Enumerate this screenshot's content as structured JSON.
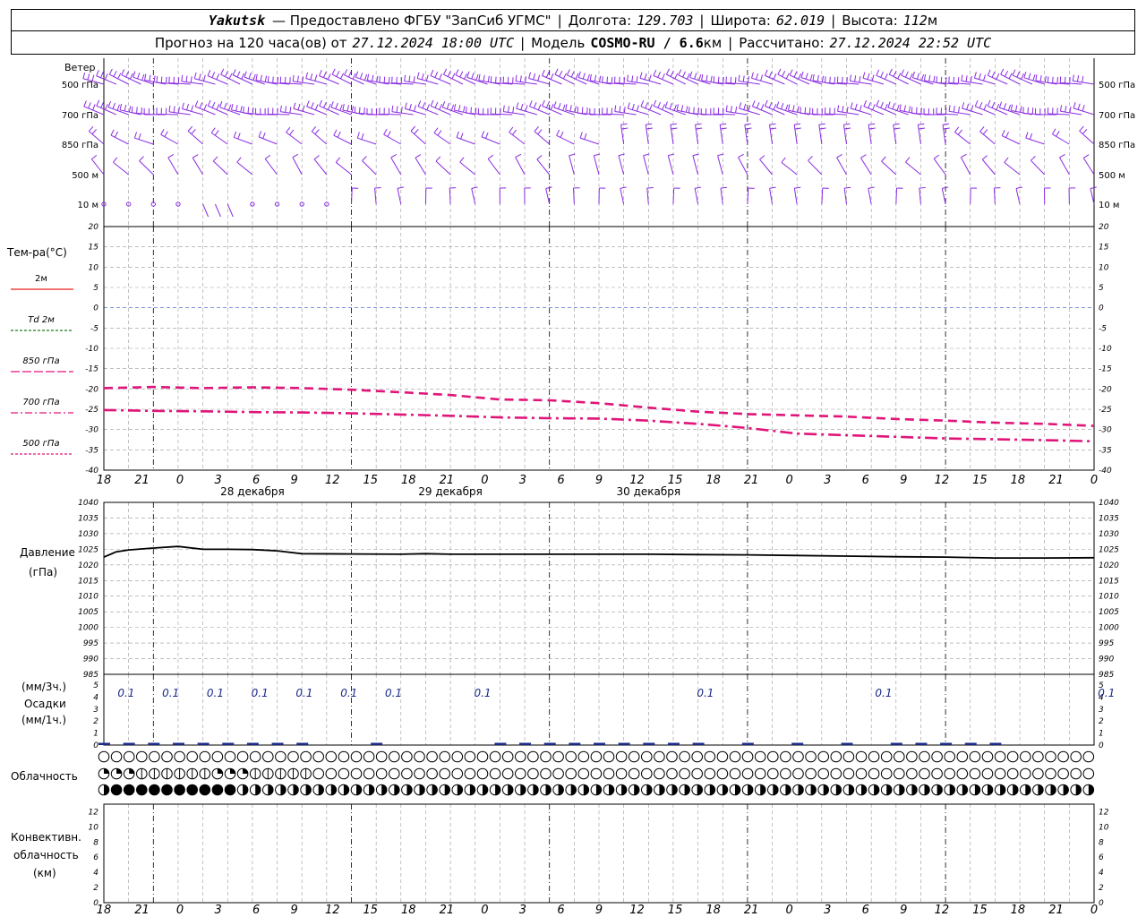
{
  "header": {
    "city": "Yakutsk",
    "provider": "— Предоставлено ФГБУ \"ЗапСиб УГМС\"",
    "lon_label": "Долгота:",
    "lon": "129.703",
    "lat_label": "Широта:",
    "lat": "62.019",
    "alt_label": "Высота:",
    "alt": "112",
    "alt_unit": "м",
    "forecast_label": "Прогноз на 120 часа(ов) от",
    "forecast_start": "27.12.2024 18:00 UTC",
    "model_label": "Модель",
    "model": "COSMO-RU / 6.6",
    "model_unit": "км",
    "calc_label": "Рассчитано:",
    "calc_time": "27.12.2024 22:52 UTC"
  },
  "colors": {
    "wind": "#8a2be2",
    "temp": "#e0157a",
    "zero_line": "#3355cc",
    "grid": "#999999",
    "precip": "#1a2a8a",
    "legend_2m": "#e82020",
    "legend_td": "#1a7a1a"
  },
  "chart_data": [
    {
      "panel": "wind",
      "type": "wind-barbs",
      "title": "Ветер",
      "levels": [
        "500 гПа",
        "700 гПа",
        "850 гПа",
        "500 м",
        "10 м"
      ]
    },
    {
      "panel": "temperature",
      "type": "line",
      "ylabel": "Тем-ра(°C)",
      "ylim": [
        -40,
        20
      ],
      "yticks": [
        20,
        15,
        10,
        5,
        0,
        -5,
        -10,
        -15,
        -20,
        -25,
        -30,
        -35,
        -40
      ],
      "legend": [
        {
          "name": "2м",
          "style": "solid",
          "color_key": "legend_2m"
        },
        {
          "name": "Td 2м",
          "style": "dashed",
          "color_key": "legend_td"
        },
        {
          "name": "850 гПа",
          "style": "long-dash",
          "color_key": "temp"
        },
        {
          "name": "700 гПа",
          "style": "dash-dot",
          "color_key": "temp"
        },
        {
          "name": "500 гПа",
          "style": "dashed",
          "color_key": "temp"
        }
      ],
      "series": [
        {
          "name": "850 гПа",
          "x_hours": [
            0,
            6,
            12,
            18,
            24,
            30,
            36,
            42,
            48,
            54,
            60,
            66,
            72,
            78,
            84,
            90,
            96,
            102,
            108,
            114,
            120
          ],
          "values": [
            -19.8,
            -19.5,
            -19.8,
            -19.6,
            -19.8,
            -20.2,
            -20.8,
            -21.5,
            -22.6,
            -22.8,
            -23.5,
            -24.6,
            -25.6,
            -26.2,
            -26.5,
            -26.8,
            -27.4,
            -27.8,
            -28.3,
            -28.6,
            -29.1
          ]
        },
        {
          "name": "700 гПа",
          "x_hours": [
            0,
            6,
            12,
            18,
            24,
            30,
            36,
            42,
            48,
            54,
            60,
            66,
            72,
            78,
            84,
            90,
            96,
            102,
            108,
            114,
            120
          ],
          "values": [
            -25.2,
            -25.4,
            -25.5,
            -25.7,
            -25.8,
            -26.0,
            -26.3,
            -26.6,
            -27.0,
            -27.2,
            -27.3,
            -27.8,
            -28.6,
            -29.6,
            -31.0,
            -31.4,
            -31.8,
            -32.2,
            -32.4,
            -32.6,
            -32.9
          ]
        }
      ],
      "x_labels": [
        "18",
        "21",
        "0",
        "3",
        "6",
        "9",
        "12",
        "15",
        "18",
        "21",
        "0",
        "3",
        "6",
        "9",
        "12",
        "15",
        "18",
        "21",
        "0",
        "3",
        "6",
        "9",
        "12",
        "15",
        "18",
        "21",
        "0"
      ],
      "day_labels": [
        "28 декабря",
        "29 декабря",
        "30 декабря"
      ]
    },
    {
      "panel": "pressure",
      "type": "line",
      "ylabel": "Давление",
      "yunit": "(гПа)",
      "ylim": [
        985,
        1040
      ],
      "yticks": [
        1040,
        1035,
        1030,
        1025,
        1020,
        1015,
        1010,
        1005,
        1000,
        995,
        990,
        985
      ],
      "series": [
        {
          "name": "Давление",
          "x_hours": [
            0,
            1.5,
            3,
            6,
            9,
            12,
            15,
            18,
            21,
            24,
            30,
            36,
            39,
            42,
            48,
            54,
            60,
            66,
            72,
            78,
            84,
            90,
            96,
            102,
            108,
            114,
            120
          ],
          "values": [
            1022.5,
            1024.2,
            1024.8,
            1025.4,
            1025.9,
            1025.0,
            1025.0,
            1024.9,
            1024.5,
            1023.6,
            1023.5,
            1023.4,
            1023.6,
            1023.4,
            1023.4,
            1023.4,
            1023.4,
            1023.4,
            1023.3,
            1023.2,
            1023.0,
            1022.8,
            1022.6,
            1022.5,
            1022.2,
            1022.2,
            1022.3
          ]
        }
      ]
    },
    {
      "panel": "precipitation",
      "type": "bar",
      "ylabel_top": "(мм/3ч.)",
      "ylabel": "Осадки",
      "ylabel_bottom": "(мм/1ч.)",
      "ylim": [
        0,
        5
      ],
      "yticks": [
        5,
        4,
        3,
        2,
        1,
        0
      ],
      "x_hours": [
        0,
        3,
        6,
        9,
        12,
        15,
        18,
        21,
        24,
        33,
        48,
        51,
        54,
        57,
        60,
        63,
        66,
        69,
        72,
        78,
        84,
        90,
        96,
        99,
        102,
        105,
        108
      ],
      "values_label": "0.1",
      "label_hours": [
        3,
        9,
        15,
        21,
        27,
        33,
        39,
        51,
        81,
        105,
        135
      ],
      "labels": [
        "0.1",
        "0.1",
        "0.1",
        "0.1",
        "0.1",
        "0.1",
        "0.1",
        "0.1",
        "0.1",
        "0.1",
        "0.1"
      ]
    },
    {
      "panel": "cloudiness",
      "type": "table",
      "ylabel": "Облачность",
      "rows_octas": [
        [
          0,
          0,
          0,
          0,
          0,
          0,
          0,
          0,
          0,
          0,
          0,
          0,
          0,
          0,
          0,
          0,
          0,
          0,
          0,
          0,
          0,
          0,
          0,
          0,
          0,
          0,
          0,
          0,
          0,
          0,
          0,
          0,
          0,
          0,
          0,
          0,
          0,
          0,
          0,
          0,
          0,
          0,
          0,
          0,
          0,
          0,
          0,
          0,
          0,
          0,
          0,
          0,
          0,
          0,
          0,
          0,
          0,
          0,
          0,
          0,
          0,
          0,
          0,
          0,
          0,
          0,
          0,
          0,
          0,
          0,
          0,
          0,
          0,
          0,
          0,
          0,
          0,
          0,
          0,
          0,
          0
        ],
        [
          3,
          3,
          3,
          2,
          2,
          2,
          2,
          2,
          2,
          3,
          3,
          3,
          2,
          2,
          2,
          2,
          2,
          0,
          0,
          0,
          0,
          0,
          0,
          0,
          0,
          0,
          0,
          0,
          0,
          0,
          0,
          0,
          0,
          0,
          0,
          0,
          0,
          0,
          0,
          0,
          0,
          0,
          0,
          0,
          0,
          0,
          0,
          0,
          0,
          0,
          0,
          0,
          0,
          0,
          0,
          0,
          0,
          0,
          0,
          0,
          0,
          0,
          0,
          0,
          0,
          0,
          0,
          0,
          0,
          0,
          0,
          0,
          0,
          0,
          0,
          0,
          0,
          0,
          0,
          0,
          0
        ],
        [
          4,
          8,
          8,
          8,
          8,
          8,
          8,
          8,
          8,
          8,
          8,
          4,
          4,
          4,
          4,
          4,
          4,
          4,
          4,
          4,
          4,
          4,
          4,
          4,
          4,
          4,
          4,
          4,
          4,
          4,
          4,
          4,
          4,
          4,
          4,
          4,
          4,
          4,
          4,
          4,
          4,
          4,
          4,
          4,
          4,
          4,
          4,
          4,
          4,
          4,
          4,
          4,
          4,
          4,
          4,
          4,
          4,
          4,
          4,
          4,
          4,
          4,
          4,
          4,
          4,
          4,
          4,
          4,
          4,
          4,
          4,
          4,
          4,
          4,
          4,
          4,
          4,
          4,
          4,
          4,
          4
        ]
      ]
    },
    {
      "panel": "convective",
      "type": "bar",
      "ylabel": "Конвективн.",
      "ylabel2": "облачность",
      "yunit": "(км)",
      "ylim": [
        0,
        13
      ],
      "yticks": [
        12,
        10,
        8,
        6,
        4,
        2,
        0
      ],
      "values": []
    }
  ]
}
